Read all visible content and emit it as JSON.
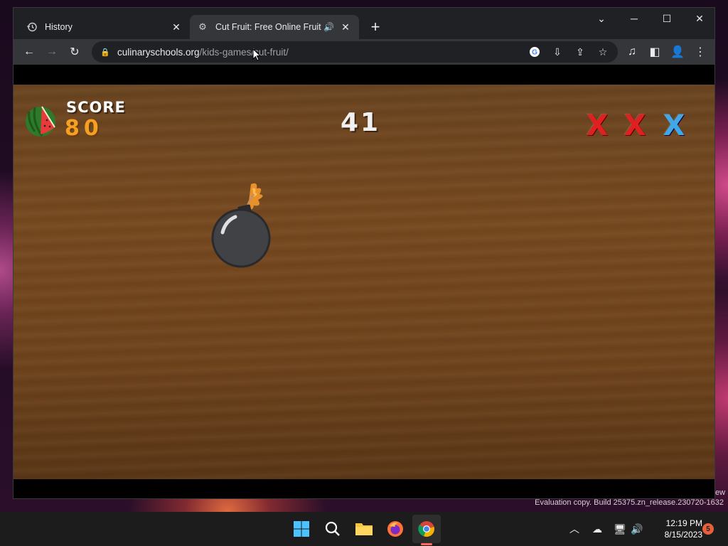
{
  "browser": {
    "tabs": [
      {
        "title": "History",
        "icon": "history-icon",
        "active": false
      },
      {
        "title": "Cut Fruit: Free Online Fruit Sl",
        "icon": "gear-favicon",
        "active": true,
        "audio": true
      }
    ],
    "url_domain": "culinaryschools.org",
    "url_path": "/kids-games/cut-fruit/"
  },
  "game": {
    "score_label": "SCORE",
    "score_value": "80",
    "timer": "41",
    "strikes": [
      {
        "state": "lost",
        "color": "#e02020"
      },
      {
        "state": "lost",
        "color": "#e02020"
      },
      {
        "state": "remaining",
        "color": "#40a8e8"
      }
    ],
    "strike_glyph": "X"
  },
  "desktop": {
    "eval_text": "Evaluation copy. Build 25375.zn_release.230720-1632",
    "corner_text": "ew"
  },
  "taskbar": {
    "apps": [
      "windows-start",
      "search",
      "file-explorer",
      "firefox",
      "chrome"
    ],
    "time": "12:19 PM",
    "date": "8/15/2023",
    "notification_count": "5"
  },
  "colors": {
    "score_value": "#f5a020",
    "wood": "#76491f"
  }
}
